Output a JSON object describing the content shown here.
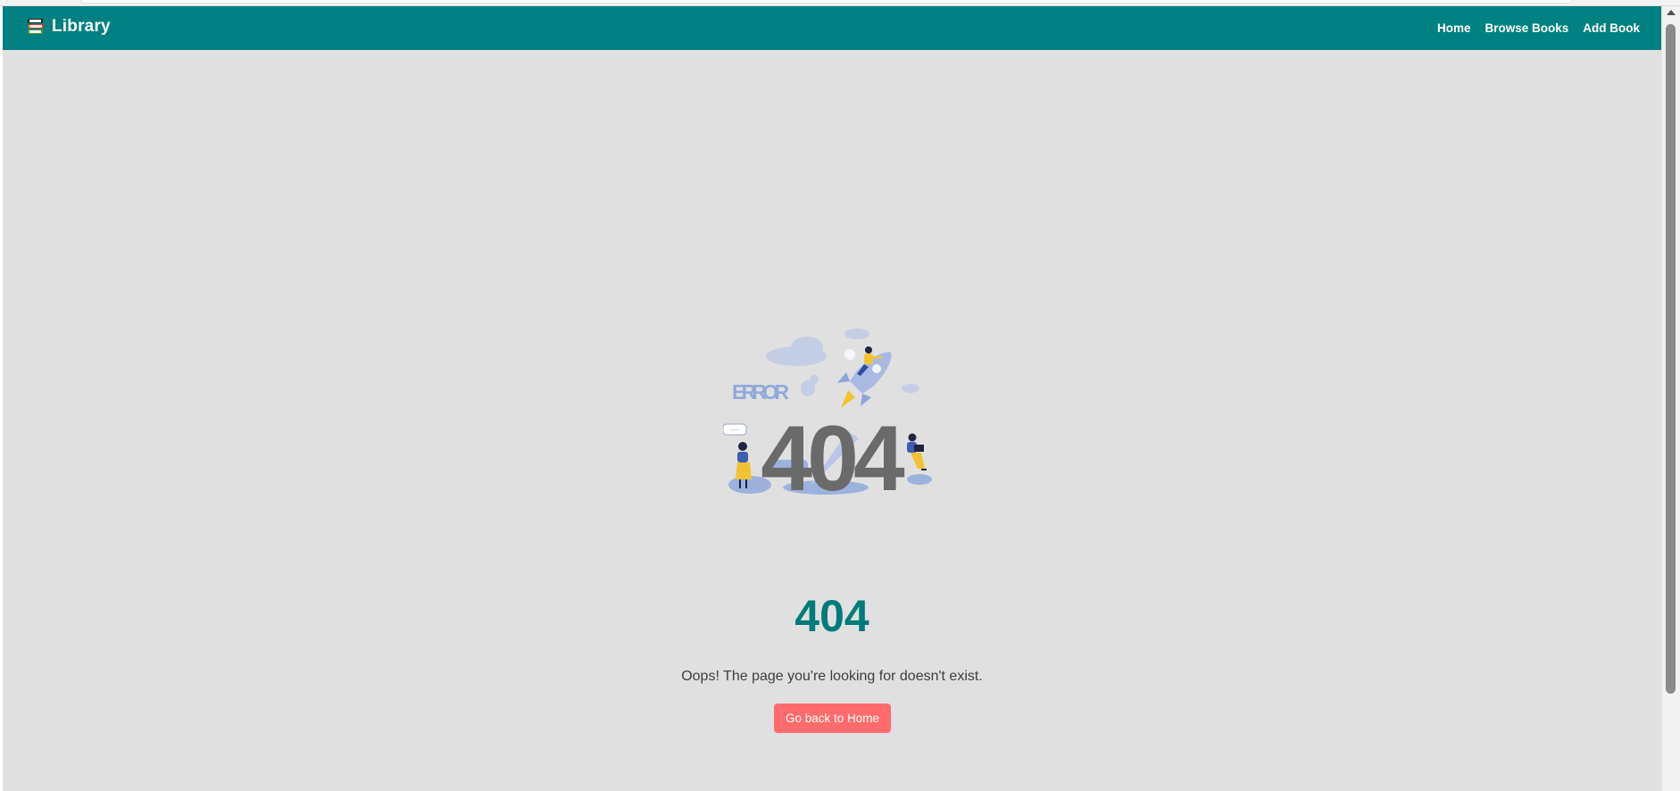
{
  "navbar": {
    "brand": "Library",
    "brand_icon": "books-icon",
    "links": [
      "Home",
      "Browse Books",
      "Add Book"
    ],
    "background": "#008080"
  },
  "illustration": {
    "label": "ERROR",
    "code": "404"
  },
  "error": {
    "code": "404",
    "message": "Oops! The page you're looking for doesn't exist.",
    "button_label": "Go back to Home"
  },
  "colors": {
    "accent": "#008080",
    "button": "#ff6b6b",
    "page_background": "#e0e0e0"
  }
}
